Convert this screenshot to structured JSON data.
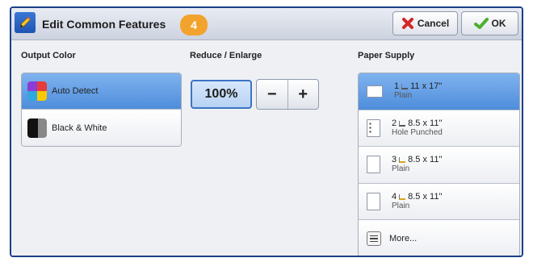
{
  "header": {
    "title": "Edit Common Features",
    "badge": "4",
    "cancel_label": "Cancel",
    "ok_label": "OK"
  },
  "output_color": {
    "label": "Output Color",
    "options": [
      {
        "label": "Auto Detect",
        "selected": true
      },
      {
        "label": "Black & White",
        "selected": false
      }
    ]
  },
  "reduce_enlarge": {
    "label": "Reduce / Enlarge",
    "value": "100%",
    "decrement": "−",
    "increment": "+"
  },
  "paper_supply": {
    "label": "Paper Supply",
    "trays": [
      {
        "tray": "1",
        "size": "11 x 17\"",
        "type": "Plain",
        "selected": true
      },
      {
        "tray": "2",
        "size": "8.5 x 11\"",
        "type": "Hole Punched",
        "selected": false
      },
      {
        "tray": "3",
        "size": "8.5 x 11\"",
        "type": "Plain",
        "selected": false
      },
      {
        "tray": "4",
        "size": "8.5 x 11\"",
        "type": "Plain",
        "selected": false
      }
    ],
    "more_label": "More..."
  },
  "colors": {
    "frame": "#1b3f86",
    "selected": "#4e8ddc",
    "badge": "#f2a32e"
  }
}
